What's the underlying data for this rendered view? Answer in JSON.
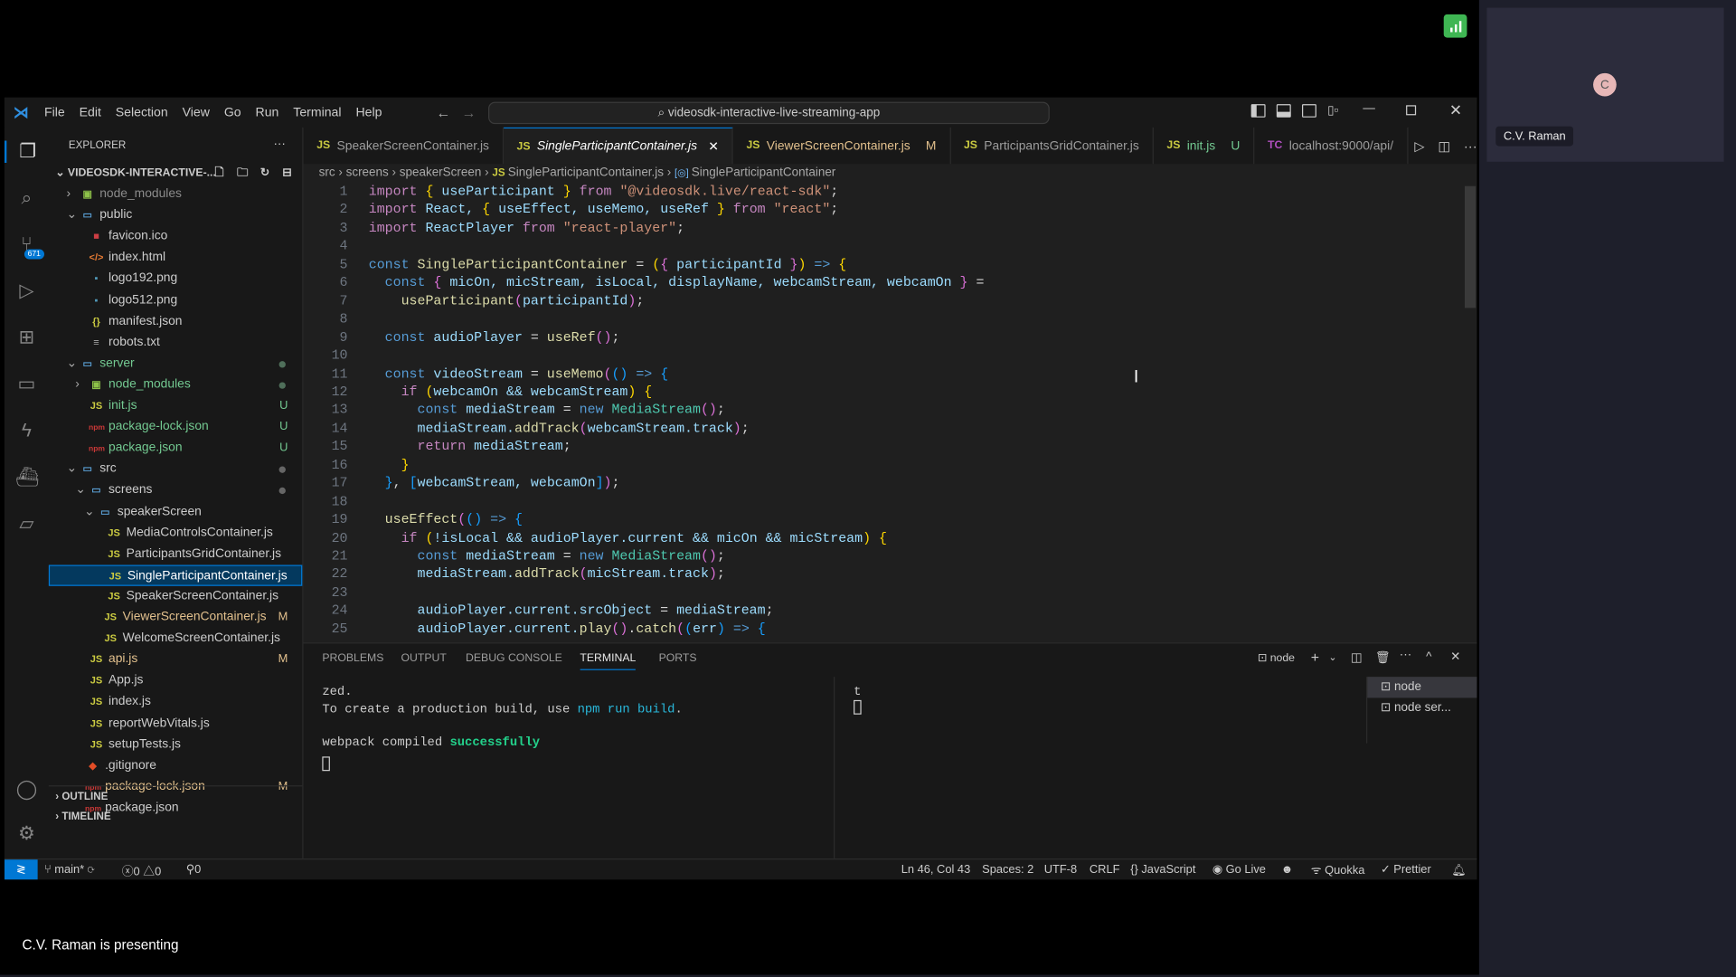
{
  "meeting": {
    "presenter_label": "C.V. Raman is presenting",
    "participant_name": "C.V. Raman",
    "avatar_initial": "C",
    "signal_color": "#3fb653"
  },
  "menu": [
    "File",
    "Edit",
    "Selection",
    "View",
    "Go",
    "Run",
    "Terminal",
    "Help"
  ],
  "search": {
    "value": "videosdk-interactive-live-streaming-app"
  },
  "activity": {
    "scm_badge": "671",
    "icons": [
      "files-icon",
      "search-icon",
      "source-control-icon",
      "run-debug-icon",
      "extensions-icon",
      "remote-explorer-icon",
      "thunder-client-icon",
      "docker-icon",
      "chat-icon",
      "account-icon",
      "settings-icon"
    ]
  },
  "explorer": {
    "title": "EXPLORER",
    "more": "···",
    "root": "VIDEOSDK-INTERACTIVE-...",
    "items": [
      {
        "label": "node_modules",
        "depth": 1,
        "type": "folder-node",
        "chev": "›",
        "color": "#8b8b8b"
      },
      {
        "label": "public",
        "depth": 1,
        "type": "folder",
        "chev": "⌄",
        "color": "#ccc"
      },
      {
        "label": "favicon.ico",
        "depth": 2,
        "type": "ico",
        "color": "#ccc"
      },
      {
        "label": "index.html",
        "depth": 2,
        "type": "html",
        "color": "#ccc"
      },
      {
        "label": "logo192.png",
        "depth": 2,
        "type": "img",
        "color": "#ccc"
      },
      {
        "label": "logo512.png",
        "depth": 2,
        "type": "img",
        "color": "#ccc"
      },
      {
        "label": "manifest.json",
        "depth": 2,
        "type": "json",
        "color": "#ccc"
      },
      {
        "label": "robots.txt",
        "depth": 2,
        "type": "txt",
        "color": "#ccc"
      },
      {
        "label": "server",
        "depth": 1,
        "type": "folder",
        "chev": "⌄",
        "color": "#73c991",
        "dot": "#4f6f5a"
      },
      {
        "label": "node_modules",
        "depth": 2,
        "type": "folder-node",
        "chev": "›",
        "color": "#73c991",
        "dot": "#4f6f5a"
      },
      {
        "label": "init.js",
        "depth": 2,
        "type": "js",
        "color": "#73c991",
        "badge": "U"
      },
      {
        "label": "package-lock.json",
        "depth": 2,
        "type": "npm",
        "color": "#73c991",
        "badge": "U"
      },
      {
        "label": "package.json",
        "depth": 2,
        "type": "npm",
        "color": "#73c991",
        "badge": "U"
      },
      {
        "label": "src",
        "depth": 1,
        "type": "folder",
        "chev": "⌄",
        "color": "#ccc",
        "dot": "#666"
      },
      {
        "label": "screens",
        "depth": 2,
        "type": "folder",
        "chev": "⌄",
        "color": "#ccc",
        "dot": "#666"
      },
      {
        "label": "speakerScreen",
        "depth": 3,
        "type": "folder",
        "chev": "⌄",
        "color": "#ccc"
      },
      {
        "label": "MediaControlsContainer.js",
        "depth": 4,
        "type": "js",
        "color": "#ccc"
      },
      {
        "label": "ParticipantsGridContainer.js",
        "depth": 4,
        "type": "js",
        "color": "#ccc"
      },
      {
        "label": "SingleParticipantContainer.js",
        "depth": 4,
        "type": "js",
        "color": "#fff",
        "selected": true
      },
      {
        "label": "SpeakerScreenContainer.js",
        "depth": 4,
        "type": "js",
        "color": "#ccc"
      },
      {
        "label": "ViewerScreenContainer.js",
        "depth": 3.6,
        "type": "js",
        "color": "#e2c08d",
        "badge": "M"
      },
      {
        "label": "WelcomeScreenContainer.js",
        "depth": 3.6,
        "type": "js",
        "color": "#ccc"
      },
      {
        "label": "api.js",
        "depth": 2,
        "type": "js",
        "color": "#e2c08d",
        "badge": "M"
      },
      {
        "label": "App.js",
        "depth": 2,
        "type": "js",
        "color": "#ccc"
      },
      {
        "label": "index.js",
        "depth": 2,
        "type": "js",
        "color": "#ccc"
      },
      {
        "label": "reportWebVitals.js",
        "depth": 2,
        "type": "js",
        "color": "#ccc"
      },
      {
        "label": "setupTests.js",
        "depth": 2,
        "type": "js",
        "color": "#ccc"
      },
      {
        "label": ".gitignore",
        "depth": 1.6,
        "type": "git",
        "color": "#ccc"
      },
      {
        "label": "package-lock.json",
        "depth": 1.6,
        "type": "npm",
        "color": "#e2c08d",
        "badge": "M"
      },
      {
        "label": "package.json",
        "depth": 1.6,
        "type": "npm",
        "color": "#ccc"
      }
    ],
    "outline": "OUTLINE",
    "timeline": "TIMELINE"
  },
  "tabs": [
    {
      "icon": "JS",
      "label": "SpeakerScreenContainer.js"
    },
    {
      "icon": "JS",
      "label": "SingleParticipantContainer.js",
      "active": true,
      "close": "✕"
    },
    {
      "icon": "JS",
      "label": "ViewerScreenContainer.js",
      "badge": "M",
      "color": "#e2c08d"
    },
    {
      "icon": "JS",
      "label": "ParticipantsGridContainer.js"
    },
    {
      "icon": "JS",
      "label": "init.js",
      "badge": "U",
      "color": "#73c991"
    },
    {
      "icon": "TC",
      "label": "localhost:9000/api/"
    }
  ],
  "breadcrumb": [
    "src",
    "screens",
    "speakerScreen",
    "SingleParticipantContainer.js",
    "SingleParticipantContainer"
  ],
  "code": [
    [
      [
        "import",
        "i"
      ],
      [
        " { ",
        "b1"
      ],
      [
        "useParticipant",
        "v"
      ],
      [
        " } ",
        "b1"
      ],
      [
        "from",
        "i"
      ],
      [
        " \"@videosdk.live/react-sdk\"",
        "s"
      ],
      [
        ";",
        "p"
      ]
    ],
    [
      [
        "import",
        "i"
      ],
      [
        " React, ",
        "v"
      ],
      [
        "{ ",
        "b1"
      ],
      [
        "useEffect, useMemo, useRef",
        "v"
      ],
      [
        " } ",
        "b1"
      ],
      [
        "from",
        "i"
      ],
      [
        " \"react\"",
        "s"
      ],
      [
        ";",
        "p"
      ]
    ],
    [
      [
        "import",
        "i"
      ],
      [
        " ReactPlayer ",
        "v"
      ],
      [
        "from",
        "i"
      ],
      [
        " \"react-player\"",
        "s"
      ],
      [
        ";",
        "p"
      ]
    ],
    [],
    [
      [
        "const",
        "k"
      ],
      [
        " SingleParticipantContainer ",
        "f"
      ],
      [
        "= ",
        "p"
      ],
      [
        "(",
        "b1"
      ],
      [
        "{ ",
        "b2"
      ],
      [
        "participantId",
        "v"
      ],
      [
        " }",
        "b2"
      ],
      [
        ")",
        "b1"
      ],
      [
        " => ",
        "k"
      ],
      [
        "{",
        "b1"
      ]
    ],
    [
      [
        "  const",
        "k"
      ],
      [
        " {",
        "b2"
      ],
      [
        " micOn, micStream, isLocal, displayName, webcamStream, webcamOn",
        "v"
      ],
      [
        " }",
        "b2"
      ],
      [
        " =",
        "p"
      ]
    ],
    [
      [
        "    useParticipant",
        "f"
      ],
      [
        "(",
        "b2"
      ],
      [
        "participantId",
        "v"
      ],
      [
        ")",
        "b2"
      ],
      [
        ";",
        "p"
      ]
    ],
    [],
    [
      [
        "  const",
        "k"
      ],
      [
        " audioPlayer ",
        "v"
      ],
      [
        "= ",
        "p"
      ],
      [
        "useRef",
        "f"
      ],
      [
        "()",
        "b2"
      ],
      [
        ";",
        "p"
      ]
    ],
    [],
    [
      [
        "  const",
        "k"
      ],
      [
        " videoStream ",
        "v"
      ],
      [
        "= ",
        "p"
      ],
      [
        "useMemo",
        "f"
      ],
      [
        "(",
        "b2"
      ],
      [
        "()",
        "b3"
      ],
      [
        " => ",
        "k"
      ],
      [
        "{",
        "b3"
      ]
    ],
    [
      [
        "    if",
        "i"
      ],
      [
        " (",
        "b1"
      ],
      [
        "webcamOn && webcamStream",
        "v"
      ],
      [
        ") {",
        "b1"
      ]
    ],
    [
      [
        "      const",
        "k"
      ],
      [
        " mediaStream ",
        "v"
      ],
      [
        "= ",
        "p"
      ],
      [
        "new ",
        "k"
      ],
      [
        "MediaStream",
        "c"
      ],
      [
        "()",
        "b2"
      ],
      [
        ";",
        "p"
      ]
    ],
    [
      [
        "      mediaStream.",
        "v"
      ],
      [
        "addTrack",
        "f"
      ],
      [
        "(",
        "b2"
      ],
      [
        "webcamStream.track",
        "v"
      ],
      [
        ")",
        "b2"
      ],
      [
        ";",
        "p"
      ]
    ],
    [
      [
        "      return",
        "i"
      ],
      [
        " mediaStream",
        "v"
      ],
      [
        ";",
        "p"
      ]
    ],
    [
      [
        "    }",
        "b1"
      ]
    ],
    [
      [
        "  }",
        "b3"
      ],
      [
        ", ",
        "p"
      ],
      [
        "[",
        "b3"
      ],
      [
        "webcamStream, webcamOn",
        "v"
      ],
      [
        "]",
        "b3"
      ],
      [
        ")",
        "b2"
      ],
      [
        ";",
        "p"
      ]
    ],
    [],
    [
      [
        "  useEffect",
        "f"
      ],
      [
        "(",
        "b2"
      ],
      [
        "()",
        "b3"
      ],
      [
        " => ",
        "k"
      ],
      [
        "{",
        "b3"
      ]
    ],
    [
      [
        "    if",
        "i"
      ],
      [
        " (",
        "b1"
      ],
      [
        "!isLocal && audioPlayer.current && micOn && micStream",
        "v"
      ],
      [
        ") {",
        "b1"
      ]
    ],
    [
      [
        "      const",
        "k"
      ],
      [
        " mediaStream ",
        "v"
      ],
      [
        "= ",
        "p"
      ],
      [
        "new ",
        "k"
      ],
      [
        "MediaStream",
        "c"
      ],
      [
        "()",
        "b2"
      ],
      [
        ";",
        "p"
      ]
    ],
    [
      [
        "      mediaStream.",
        "v"
      ],
      [
        "addTrack",
        "f"
      ],
      [
        "(",
        "b2"
      ],
      [
        "micStream.track",
        "v"
      ],
      [
        ")",
        "b2"
      ],
      [
        ";",
        "p"
      ]
    ],
    [],
    [
      [
        "      audioPlayer.current.srcObject ",
        "v"
      ],
      [
        "= ",
        "p"
      ],
      [
        "mediaStream",
        "v"
      ],
      [
        ";",
        "p"
      ]
    ],
    [
      [
        "      audioPlayer.current.",
        "v"
      ],
      [
        "play",
        "f"
      ],
      [
        "()",
        "b2"
      ],
      [
        ".",
        "p"
      ],
      [
        "catch",
        "f"
      ],
      [
        "(",
        "b2"
      ],
      [
        "(",
        "b3"
      ],
      [
        "err",
        "v"
      ],
      [
        ")",
        "b3"
      ],
      [
        " => ",
        "k"
      ],
      [
        "{",
        "b3"
      ]
    ]
  ],
  "panel": {
    "tabs": [
      "PROBLEMS",
      "OUTPUT",
      "DEBUG CONSOLE",
      "TERMINAL",
      "PORTS"
    ],
    "active": "TERMINAL",
    "shell": "node",
    "terminal_lines": {
      "l1": "zed.",
      "l2a": "To create a production build, use ",
      "l2b": "npm run build",
      "l2c": ".",
      "l3a": "webpack compiled ",
      "l3b": "successfully"
    },
    "right_terminal": "t",
    "terminals": [
      "node",
      "node ser..."
    ]
  },
  "status": {
    "branch": "main*",
    "errors": "0",
    "warnings": "0",
    "ports": "0",
    "position": "Ln 46, Col 43",
    "spaces": "Spaces: 2",
    "encoding": "UTF-8",
    "eol": "CRLF",
    "language": "JavaScript",
    "golive": "Go Live",
    "quokka": "Quokka",
    "prettier": "Prettier"
  }
}
